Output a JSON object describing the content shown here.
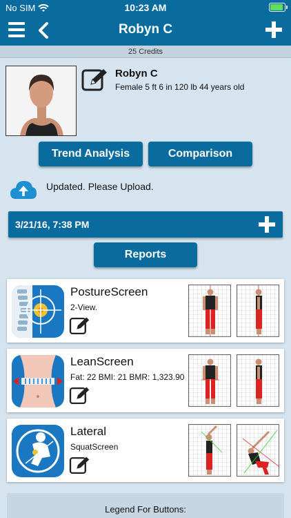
{
  "status": {
    "carrier": "No SIM",
    "time": "10:23 AM"
  },
  "nav": {
    "title": "Robyn C"
  },
  "credits": "25 Credits",
  "profile": {
    "name": "Robyn C",
    "info": "Female 5 ft 6 in 120 lb 44 years old"
  },
  "buttons": {
    "trend": "Trend Analysis",
    "comparison": "Comparison",
    "reports": "Reports"
  },
  "upload_message": "Updated. Please Upload.",
  "assessment_date": "3/21/16, 7:38 PM",
  "cards": [
    {
      "name": "PostureScreen",
      "sub": "2-View."
    },
    {
      "name": "LeanScreen",
      "sub": "Fat: 22 BMI: 21 BMR: 1,323.90"
    },
    {
      "name": "Lateral",
      "sub": "SquatScreen"
    }
  ],
  "legend": "Legend For Buttons:",
  "colors": {
    "primary": "#0a6b9e",
    "background": "#d6e4ef",
    "battery": "#5ce05c"
  }
}
